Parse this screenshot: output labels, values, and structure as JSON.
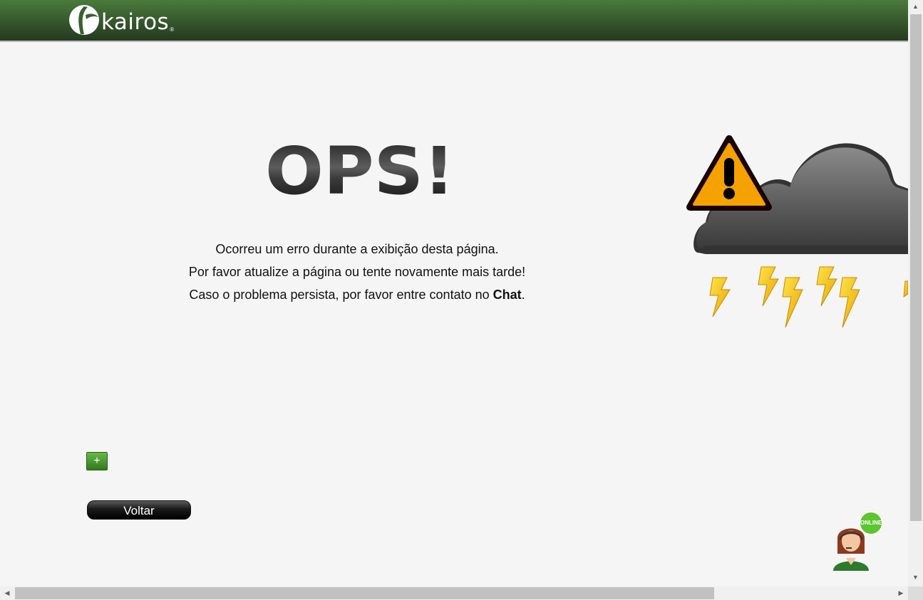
{
  "header": {
    "logo_text": "kairos",
    "logo_registered": "®",
    "background_color": "#3a6030"
  },
  "error": {
    "title": "OPS!",
    "line1": "Ocorreu um erro durante a exibição desta página.",
    "line2": "Por favor atualize a página ou tente novamente mais tarde!",
    "line3_prefix": "Caso o problema persista, por favor entre contato no ",
    "line3_bold": "Chat",
    "line3_suffix": "."
  },
  "illustration": {
    "icons": [
      "warning-icon",
      "cloud-icon",
      "lightning-bolt-icon"
    ],
    "warning_color": "#f5a200",
    "cloud_color": "#555555",
    "bolt_color": "#f7c400"
  },
  "actions": {
    "expand_label": "+",
    "back_label": "Voltar",
    "button_accent": "#3d8f25"
  },
  "chat": {
    "status_label": "ONLINE",
    "status_color": "#5dc52f",
    "icon": "support-agent-icon"
  },
  "scrollbars": {
    "up_arrow": "▲",
    "down_arrow": "▼",
    "left_arrow": "◀",
    "right_arrow": "▶"
  }
}
